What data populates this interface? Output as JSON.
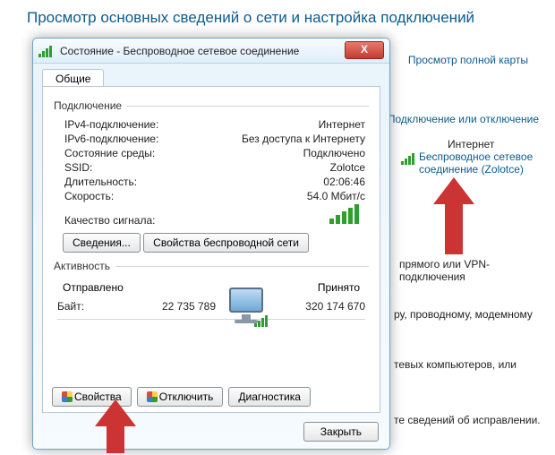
{
  "page": {
    "title": "Просмотр основных сведений о сети и настройка подключений",
    "map_link": "Просмотр полной карты",
    "conn_link": "Подключение или отключение",
    "internet_label": "Интернет",
    "wifi_link_l1": "Беспроводное сетевое",
    "wifi_link_l2": "соединение (Zolotce)"
  },
  "right_snippets": {
    "r1": "прямого или VPN-подключения",
    "r2": "ру, проводному, модемному",
    "r3": "тевых компьютеров, или",
    "r4": "те сведений об исправлении."
  },
  "dialog": {
    "title": "Состояние - Беспроводное сетевое соединение",
    "close": "X",
    "tab_general": "Общие",
    "group_conn": "Подключение",
    "rows": {
      "ipv4_k": "IPv4-подключение:",
      "ipv4_v": "Интернет",
      "ipv6_k": "IPv6-подключение:",
      "ipv6_v": "Без доступа к Интернету",
      "media_k": "Состояние среды:",
      "media_v": "Подключено",
      "ssid_k": "SSID:",
      "ssid_v": "Zolotce",
      "dur_k": "Длительность:",
      "dur_v": "02:06:46",
      "speed_k": "Скорость:",
      "speed_v": "54.0 Мбит/с",
      "signal_k": "Качество сигнала:"
    },
    "btn_details": "Сведения...",
    "btn_wprops": "Свойства беспроводной сети",
    "group_activity": "Активность",
    "sent_label": "Отправлено",
    "recv_label": "Принято",
    "bytes_label": "Байт:",
    "sent_bytes": "22 735 789",
    "recv_bytes": "320 174 670",
    "btn_props": "Свойства",
    "btn_disable": "Отключить",
    "btn_diag": "Диагностика",
    "btn_close": "Закрыть"
  }
}
